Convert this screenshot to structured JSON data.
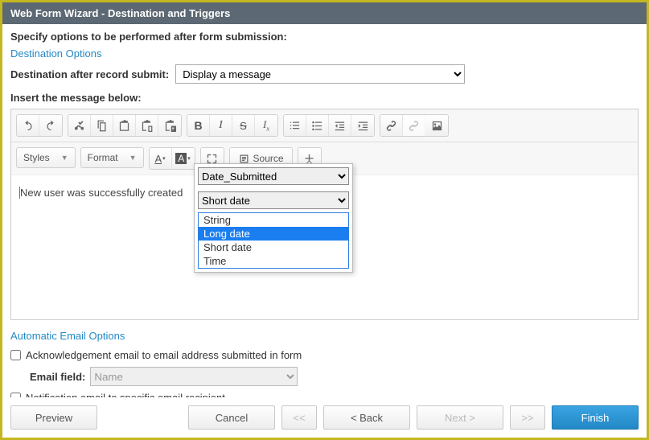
{
  "title": "Web Form Wizard - Destination and Triggers",
  "instruction": "Specify options to be performed after form submission:",
  "destination": {
    "heading": "Destination Options",
    "label": "Destination after record submit:",
    "select_value": "Display a message"
  },
  "message_label": "Insert the message below:",
  "toolbar": {
    "styles": "Styles",
    "format": "Format",
    "source": "Source"
  },
  "editor_text": "New user was successfully created",
  "popup": {
    "field": "Date_Submitted",
    "format_selected": "Short date",
    "options": [
      "String",
      "Long date",
      "Short date",
      "Time"
    ],
    "highlighted": "Long date"
  },
  "auto_email": {
    "heading": "Automatic Email Options",
    "ack_label": "Acknowledgement email to email address submitted in form",
    "email_field_label": "Email field:",
    "email_field_value": "Name",
    "notify_label": "Notification email to specific email recipient"
  },
  "footer": {
    "preview": "Preview",
    "cancel": "Cancel",
    "first": "<<",
    "back": "< Back",
    "next": "Next >",
    "last": ">>",
    "finish": "Finish"
  }
}
